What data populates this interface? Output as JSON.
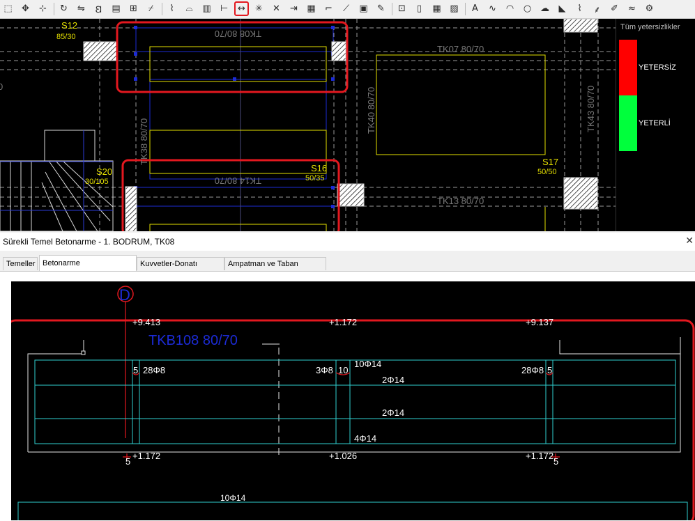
{
  "toolbar": {
    "icons": [
      "select-region",
      "pan",
      "pan-grid",
      "rotate",
      "mirror",
      "text-style",
      "layer",
      "grid-mark",
      "line-break",
      "line-cut",
      "arc-tool",
      "bar-chart",
      "line-end",
      "dimension-move",
      "snap",
      "trim",
      "extend",
      "rebar-column",
      "fillet",
      "chamfer",
      "array",
      "brush",
      "grid-snap",
      "object-snap",
      "table-grid",
      "image",
      "text",
      "polyline",
      "arc",
      "circle",
      "cloud",
      "hatch",
      "waveform",
      "section-mark",
      "edit-text",
      "measure",
      "settings"
    ]
  },
  "plan": {
    "labels": {
      "s12": "S12",
      "s12_dim": "85/30",
      "s20": "S20",
      "s20_dim": "30/105",
      "s16": "S16",
      "s16_dim": "50/35",
      "s17": "S17",
      "s17_dim": "50/50",
      "tk_top": "TK08 80/70",
      "tk07": "TK07 80/70",
      "tk14": "TK14 80/70",
      "tk13": "TK13 80/70",
      "tk38": "TK38 80/70",
      "tk40": "TK40 80/70",
      "tk43": "TK43 80/70",
      "left_cut": "0"
    }
  },
  "legend": {
    "title": "Tüm yetersizlikler",
    "insufficient": "YETERSİZ",
    "sufficient": "YETERLİ",
    "colors": {
      "insufficient": "#ff0000",
      "sufficient": "#00ff3c"
    }
  },
  "panel": {
    "title": "Sürekli Temel Betonarme - 1. BODRUM, TK08",
    "close": "✕"
  },
  "tabs": [
    {
      "label": "Temeller",
      "active": false
    },
    {
      "label": "Betonarme Konfigürasyonu",
      "active": true
    },
    {
      "label": "Kuvvetler-Donatı Alanları",
      "active": false
    },
    {
      "label": "Ampatman ve Taban Basıncı",
      "active": false
    }
  ],
  "detail": {
    "axis": "D",
    "beam": "TKB108 80/70",
    "elev_top_left": "+9.413",
    "elev_top_mid": "+1.172",
    "elev_top_right": "+9.137",
    "elev_bot_left": "+1.172",
    "elev_bot_mid": "+1.026",
    "elev_bot_right": "+1.172",
    "stirrup_left_n": "5",
    "stirrup_left": "28Φ8",
    "stirrup_mid_pre": "3Φ8",
    "stirrup_mid_n": "10",
    "top_bars": "10Φ14",
    "side_bars_1": "2Φ14",
    "side_bars_2": "2Φ14",
    "bottom_bars": "4Φ14",
    "stirrup_right": "28Φ8",
    "stirrup_right_n": "5",
    "bot_left_n": "5",
    "bot_right_n": "5",
    "lower_bars": "10Φ14"
  }
}
